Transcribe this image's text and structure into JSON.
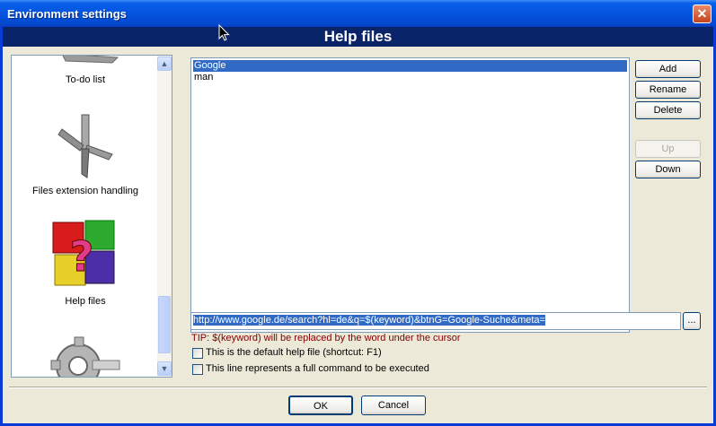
{
  "window": {
    "title": "Environment settings",
    "close_glyph": "✕"
  },
  "header": {
    "title": "Help files"
  },
  "sidebar": {
    "items": [
      {
        "label": "To-do list",
        "icon": "todo-list-icon"
      },
      {
        "label": "Files extension handling",
        "icon": "file-extension-icon"
      },
      {
        "label": "Help files",
        "icon": "help-files-icon"
      },
      {
        "label": "",
        "icon": "gear-icon"
      }
    ],
    "scroll_up_glyph": "▲",
    "scroll_down_glyph": "▼"
  },
  "help_list": {
    "items": [
      {
        "label": "Google",
        "selected": true
      },
      {
        "label": "man",
        "selected": false
      }
    ]
  },
  "buttons": {
    "add": "Add",
    "rename": "Rename",
    "delete": "Delete",
    "up": "Up",
    "down": "Down",
    "browse": "..."
  },
  "url_field": {
    "value": "http://www.google.de/search?hl=de&q=$(keyword)&btnG=Google-Suche&meta="
  },
  "tip": "TIP: $(keyword) will be replaced by the word under the cursor",
  "checkboxes": {
    "default_help": {
      "label": "This is the default help file (shortcut: F1)",
      "checked": false
    },
    "full_command": {
      "label": "This line represents a full command to be executed",
      "checked": false
    }
  },
  "footer": {
    "ok": "OK",
    "cancel": "Cancel"
  },
  "colors": {
    "title_bar": "#0453df",
    "header_band": "#0a246a",
    "selection": "#316ac5",
    "tip_text": "#800000",
    "dialog_bg": "#ece9d8"
  }
}
